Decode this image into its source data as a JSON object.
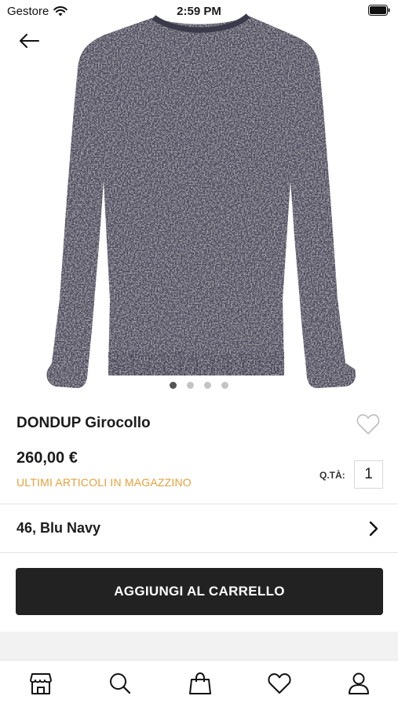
{
  "status_bar": {
    "carrier": "Gestore",
    "time": "2:59 PM"
  },
  "product": {
    "name": "DONDUP Girocollo",
    "price": "260,00 €",
    "stock_note": "ULTIMI ARTICOLI IN MAGAZZINO",
    "quantity_label": "Q.TÀ:",
    "quantity": "1",
    "variant": "46, Blu Navy",
    "image_count": 4,
    "active_image_index": 0,
    "favorite": false
  },
  "actions": {
    "add_to_cart": "AGGIUNGI AL CARRELLO"
  },
  "colors": {
    "accent_stock": "#e4a13a",
    "button_bg": "#222222",
    "sweater": "#4a4a5c"
  },
  "icons": {
    "back": "arrow-left-icon",
    "favorite": "heart-outline-icon",
    "variant_open": "chevron-right-icon"
  },
  "tab_bar": {
    "items": [
      {
        "name": "store",
        "icon": "store-icon"
      },
      {
        "name": "search",
        "icon": "search-icon"
      },
      {
        "name": "bag",
        "icon": "shopping-bag-icon"
      },
      {
        "name": "wishlist",
        "icon": "heart-icon"
      },
      {
        "name": "account",
        "icon": "user-icon"
      }
    ]
  }
}
